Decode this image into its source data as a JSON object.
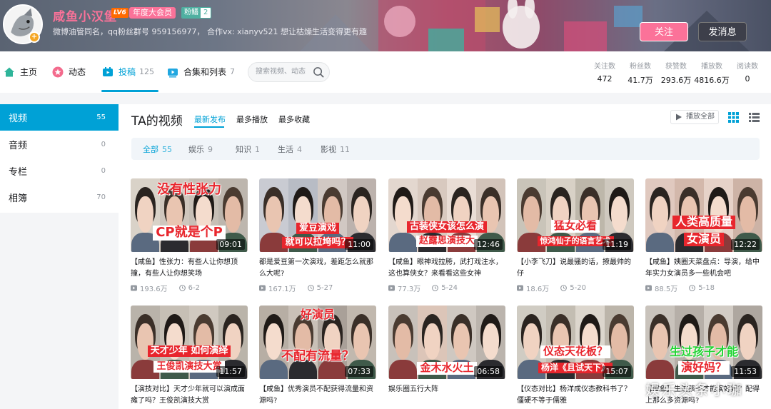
{
  "user": {
    "name": "咸鱼小汉堡",
    "level_badge": "LV6",
    "vip_label": "年度大会员",
    "medal": {
      "name": "粉鳝",
      "level": "2"
    },
    "sign": "微博油管同名，qq粉丝群号 959156977， 合作vx: xianyv521 想让枯燥生活变得更有趣"
  },
  "actions": {
    "follow_label": "关注",
    "message_label": "发消息"
  },
  "nav": {
    "items": [
      {
        "label": "主页",
        "count": ""
      },
      {
        "label": "动态",
        "count": ""
      },
      {
        "label": "投稿",
        "count": "125"
      },
      {
        "label": "合集和列表",
        "count": "7"
      }
    ],
    "search_placeholder": "搜索视频、动态"
  },
  "stats": [
    {
      "label": "关注数",
      "value": "472"
    },
    {
      "label": "粉丝数",
      "value": "41.7万"
    },
    {
      "label": "获赞数",
      "value": "293.6万"
    },
    {
      "label": "播放数",
      "value": "4816.6万"
    },
    {
      "label": "阅读数",
      "value": "0"
    }
  ],
  "sidebar": {
    "items": [
      {
        "label": "视频",
        "count": "55"
      },
      {
        "label": "音频",
        "count": "0"
      },
      {
        "label": "专栏",
        "count": "0"
      },
      {
        "label": "相簿",
        "count": "70"
      }
    ]
  },
  "main": {
    "title": "TA的视频",
    "sort_tabs": [
      "最新发布",
      "最多播放",
      "最多收藏"
    ],
    "play_all_label": "播放全部",
    "filters": [
      {
        "label": "全部",
        "count": "55"
      },
      {
        "label": "娱乐",
        "count": "9"
      },
      {
        "label": "知识",
        "count": "1"
      },
      {
        "label": "生活",
        "count": "4"
      },
      {
        "label": "影视",
        "count": "11"
      }
    ]
  },
  "videos": [
    {
      "cap_top": "没有性张力",
      "cap_bottom": "CP就是个P",
      "duration": "09:01",
      "title": "【咸鱼】性张力：有些人让你想顶撞，有些人让你想笑场",
      "views": "193.6万",
      "date": "6-2"
    },
    {
      "cap_top": "爱豆演戏",
      "cap_bottom": "就可以拉垮吗？",
      "duration": "11:00",
      "title": "都是爱豆第一次演戏，差距怎么就那么大呢?",
      "views": "167.1万",
      "date": "5-27"
    },
    {
      "cap_top": "古装侠女该怎么演",
      "cap_bottom": "赵露思演技大",
      "duration": "12:46",
      "title": "【咸鱼】眼神戏拉胯，武打戏注水，这也算侠女？来看看这些女神",
      "views": "77.3万",
      "date": "5-24"
    },
    {
      "cap_top": "猛女必看",
      "cap_bottom": "惊鸿仙子的语言艺术",
      "duration": "11:19",
      "title": "【小李飞刀】说最骚的话，撩最帅的仔",
      "views": "18.6万",
      "date": "5-20"
    },
    {
      "cap_top": "人类高质量",
      "cap_bottom": "女演员",
      "duration": "12:22",
      "title": "【咸鱼】姨圈天菜盘点：导演，给中年实力女演员多一些机会吧",
      "views": "88.5万",
      "date": "5-18"
    },
    {
      "cap_top": "天才少年 如何演绎",
      "cap_bottom": "王俊凯演技大赏",
      "duration": "11:57",
      "title": "【演技对比】天才少年就可以演成面瘫了吗？王俊凯演技大赏",
      "views": "",
      "date": ""
    },
    {
      "cap_top": "好演员",
      "cap_bottom": "不配有流量？",
      "duration": "07:33",
      "title": "【咸鱼】优秀演员不配获得流量和资源吗?",
      "views": "",
      "date": ""
    },
    {
      "cap_top": "",
      "cap_bottom": "金木水火土",
      "duration": "06:58",
      "title": "娱乐圈五行大阵",
      "views": "",
      "date": ""
    },
    {
      "cap_top": "仪态天花板？",
      "cap_bottom": "杨洋《且试天下》",
      "duration": "15:07",
      "title": "【仪态对比】杨洋成仪态教科书了？僵硬不等于儒雅",
      "views": "",
      "date": ""
    },
    {
      "cap_top": "生过孩子才能",
      "cap_bottom": "演好妈？",
      "duration": "11:53",
      "title": "【咸鱼】生过孩子才能演好妈？配得上那么多资源吗?",
      "views": "",
      "date": ""
    }
  ],
  "watermark": "娱乐头条小珈"
}
